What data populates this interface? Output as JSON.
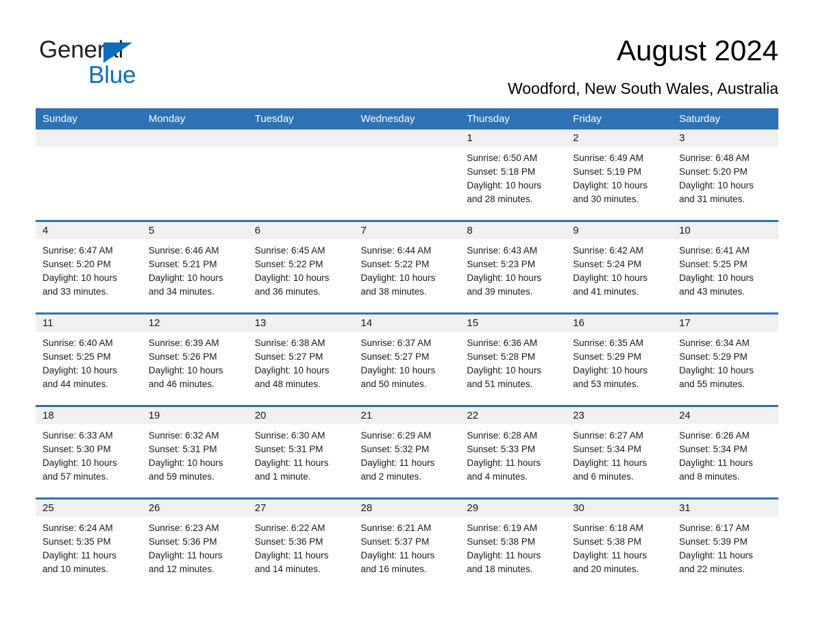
{
  "brand": {
    "name_part1": "General",
    "name_part2": "Blue",
    "triangle_icon": "triangle-logo-mark",
    "accent_color": "#0a6ebd"
  },
  "header": {
    "month_title": "August 2024",
    "location": "Woodford, New South Wales, Australia"
  },
  "theme": {
    "header_blue": "#2e72b5",
    "daynum_band": "#f0f0f0",
    "cell_background": "#ffffff",
    "text_color": "#1a1a1a"
  },
  "weekday_headers": [
    "Sunday",
    "Monday",
    "Tuesday",
    "Wednesday",
    "Thursday",
    "Friday",
    "Saturday"
  ],
  "weeks": [
    [
      {
        "day": "",
        "sunrise": "",
        "sunset": "",
        "daylight_line1": "",
        "daylight_line2": "",
        "empty": true
      },
      {
        "day": "",
        "sunrise": "",
        "sunset": "",
        "daylight_line1": "",
        "daylight_line2": "",
        "empty": true
      },
      {
        "day": "",
        "sunrise": "",
        "sunset": "",
        "daylight_line1": "",
        "daylight_line2": "",
        "empty": true
      },
      {
        "day": "",
        "sunrise": "",
        "sunset": "",
        "daylight_line1": "",
        "daylight_line2": "",
        "empty": true
      },
      {
        "day": "1",
        "sunrise": "Sunrise: 6:50 AM",
        "sunset": "Sunset: 5:18 PM",
        "daylight_line1": "Daylight: 10 hours",
        "daylight_line2": "and 28 minutes.",
        "empty": false
      },
      {
        "day": "2",
        "sunrise": "Sunrise: 6:49 AM",
        "sunset": "Sunset: 5:19 PM",
        "daylight_line1": "Daylight: 10 hours",
        "daylight_line2": "and 30 minutes.",
        "empty": false
      },
      {
        "day": "3",
        "sunrise": "Sunrise: 6:48 AM",
        "sunset": "Sunset: 5:20 PM",
        "daylight_line1": "Daylight: 10 hours",
        "daylight_line2": "and 31 minutes.",
        "empty": false
      }
    ],
    [
      {
        "day": "4",
        "sunrise": "Sunrise: 6:47 AM",
        "sunset": "Sunset: 5:20 PM",
        "daylight_line1": "Daylight: 10 hours",
        "daylight_line2": "and 33 minutes.",
        "empty": false
      },
      {
        "day": "5",
        "sunrise": "Sunrise: 6:46 AM",
        "sunset": "Sunset: 5:21 PM",
        "daylight_line1": "Daylight: 10 hours",
        "daylight_line2": "and 34 minutes.",
        "empty": false
      },
      {
        "day": "6",
        "sunrise": "Sunrise: 6:45 AM",
        "sunset": "Sunset: 5:22 PM",
        "daylight_line1": "Daylight: 10 hours",
        "daylight_line2": "and 36 minutes.",
        "empty": false
      },
      {
        "day": "7",
        "sunrise": "Sunrise: 6:44 AM",
        "sunset": "Sunset: 5:22 PM",
        "daylight_line1": "Daylight: 10 hours",
        "daylight_line2": "and 38 minutes.",
        "empty": false
      },
      {
        "day": "8",
        "sunrise": "Sunrise: 6:43 AM",
        "sunset": "Sunset: 5:23 PM",
        "daylight_line1": "Daylight: 10 hours",
        "daylight_line2": "and 39 minutes.",
        "empty": false
      },
      {
        "day": "9",
        "sunrise": "Sunrise: 6:42 AM",
        "sunset": "Sunset: 5:24 PM",
        "daylight_line1": "Daylight: 10 hours",
        "daylight_line2": "and 41 minutes.",
        "empty": false
      },
      {
        "day": "10",
        "sunrise": "Sunrise: 6:41 AM",
        "sunset": "Sunset: 5:25 PM",
        "daylight_line1": "Daylight: 10 hours",
        "daylight_line2": "and 43 minutes.",
        "empty": false
      }
    ],
    [
      {
        "day": "11",
        "sunrise": "Sunrise: 6:40 AM",
        "sunset": "Sunset: 5:25 PM",
        "daylight_line1": "Daylight: 10 hours",
        "daylight_line2": "and 44 minutes.",
        "empty": false
      },
      {
        "day": "12",
        "sunrise": "Sunrise: 6:39 AM",
        "sunset": "Sunset: 5:26 PM",
        "daylight_line1": "Daylight: 10 hours",
        "daylight_line2": "and 46 minutes.",
        "empty": false
      },
      {
        "day": "13",
        "sunrise": "Sunrise: 6:38 AM",
        "sunset": "Sunset: 5:27 PM",
        "daylight_line1": "Daylight: 10 hours",
        "daylight_line2": "and 48 minutes.",
        "empty": false
      },
      {
        "day": "14",
        "sunrise": "Sunrise: 6:37 AM",
        "sunset": "Sunset: 5:27 PM",
        "daylight_line1": "Daylight: 10 hours",
        "daylight_line2": "and 50 minutes.",
        "empty": false
      },
      {
        "day": "15",
        "sunrise": "Sunrise: 6:36 AM",
        "sunset": "Sunset: 5:28 PM",
        "daylight_line1": "Daylight: 10 hours",
        "daylight_line2": "and 51 minutes.",
        "empty": false
      },
      {
        "day": "16",
        "sunrise": "Sunrise: 6:35 AM",
        "sunset": "Sunset: 5:29 PM",
        "daylight_line1": "Daylight: 10 hours",
        "daylight_line2": "and 53 minutes.",
        "empty": false
      },
      {
        "day": "17",
        "sunrise": "Sunrise: 6:34 AM",
        "sunset": "Sunset: 5:29 PM",
        "daylight_line1": "Daylight: 10 hours",
        "daylight_line2": "and 55 minutes.",
        "empty": false
      }
    ],
    [
      {
        "day": "18",
        "sunrise": "Sunrise: 6:33 AM",
        "sunset": "Sunset: 5:30 PM",
        "daylight_line1": "Daylight: 10 hours",
        "daylight_line2": "and 57 minutes.",
        "empty": false
      },
      {
        "day": "19",
        "sunrise": "Sunrise: 6:32 AM",
        "sunset": "Sunset: 5:31 PM",
        "daylight_line1": "Daylight: 10 hours",
        "daylight_line2": "and 59 minutes.",
        "empty": false
      },
      {
        "day": "20",
        "sunrise": "Sunrise: 6:30 AM",
        "sunset": "Sunset: 5:31 PM",
        "daylight_line1": "Daylight: 11 hours",
        "daylight_line2": "and 1 minute.",
        "empty": false
      },
      {
        "day": "21",
        "sunrise": "Sunrise: 6:29 AM",
        "sunset": "Sunset: 5:32 PM",
        "daylight_line1": "Daylight: 11 hours",
        "daylight_line2": "and 2 minutes.",
        "empty": false
      },
      {
        "day": "22",
        "sunrise": "Sunrise: 6:28 AM",
        "sunset": "Sunset: 5:33 PM",
        "daylight_line1": "Daylight: 11 hours",
        "daylight_line2": "and 4 minutes.",
        "empty": false
      },
      {
        "day": "23",
        "sunrise": "Sunrise: 6:27 AM",
        "sunset": "Sunset: 5:34 PM",
        "daylight_line1": "Daylight: 11 hours",
        "daylight_line2": "and 6 minutes.",
        "empty": false
      },
      {
        "day": "24",
        "sunrise": "Sunrise: 6:26 AM",
        "sunset": "Sunset: 5:34 PM",
        "daylight_line1": "Daylight: 11 hours",
        "daylight_line2": "and 8 minutes.",
        "empty": false
      }
    ],
    [
      {
        "day": "25",
        "sunrise": "Sunrise: 6:24 AM",
        "sunset": "Sunset: 5:35 PM",
        "daylight_line1": "Daylight: 11 hours",
        "daylight_line2": "and 10 minutes.",
        "empty": false
      },
      {
        "day": "26",
        "sunrise": "Sunrise: 6:23 AM",
        "sunset": "Sunset: 5:36 PM",
        "daylight_line1": "Daylight: 11 hours",
        "daylight_line2": "and 12 minutes.",
        "empty": false
      },
      {
        "day": "27",
        "sunrise": "Sunrise: 6:22 AM",
        "sunset": "Sunset: 5:36 PM",
        "daylight_line1": "Daylight: 11 hours",
        "daylight_line2": "and 14 minutes.",
        "empty": false
      },
      {
        "day": "28",
        "sunrise": "Sunrise: 6:21 AM",
        "sunset": "Sunset: 5:37 PM",
        "daylight_line1": "Daylight: 11 hours",
        "daylight_line2": "and 16 minutes.",
        "empty": false
      },
      {
        "day": "29",
        "sunrise": "Sunrise: 6:19 AM",
        "sunset": "Sunset: 5:38 PM",
        "daylight_line1": "Daylight: 11 hours",
        "daylight_line2": "and 18 minutes.",
        "empty": false
      },
      {
        "day": "30",
        "sunrise": "Sunrise: 6:18 AM",
        "sunset": "Sunset: 5:38 PM",
        "daylight_line1": "Daylight: 11 hours",
        "daylight_line2": "and 20 minutes.",
        "empty": false
      },
      {
        "day": "31",
        "sunrise": "Sunrise: 6:17 AM",
        "sunset": "Sunset: 5:39 PM",
        "daylight_line1": "Daylight: 11 hours",
        "daylight_line2": "and 22 minutes.",
        "empty": false
      }
    ]
  ]
}
